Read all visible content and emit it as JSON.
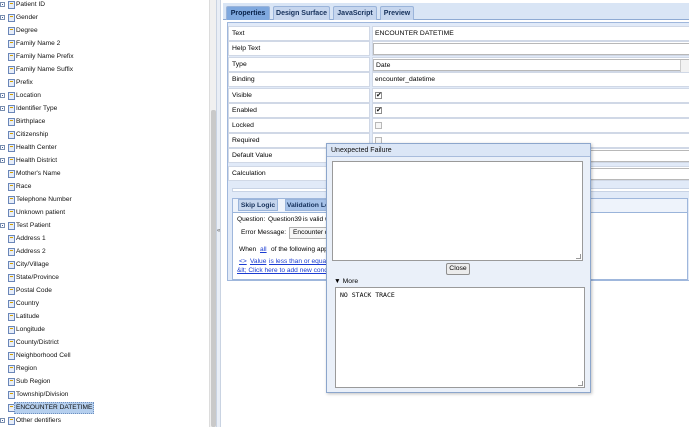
{
  "tree": {
    "items": [
      {
        "label": "Patient ID",
        "expandable": true
      },
      {
        "label": "Gender",
        "expandable": true
      },
      {
        "label": "Degree",
        "expandable": false
      },
      {
        "label": "Family Name 2",
        "expandable": false
      },
      {
        "label": "Family Name Prefix",
        "expandable": false
      },
      {
        "label": "Family Name Suffix",
        "expandable": false
      },
      {
        "label": "Prefix",
        "expandable": false
      },
      {
        "label": "Location",
        "expandable": true
      },
      {
        "label": "Identifier Type",
        "expandable": true
      },
      {
        "label": "Birthplace",
        "expandable": false
      },
      {
        "label": "Citizenship",
        "expandable": false
      },
      {
        "label": "Health Center",
        "expandable": true
      },
      {
        "label": "Health District",
        "expandable": true
      },
      {
        "label": "Mother's Name",
        "expandable": false
      },
      {
        "label": "Race",
        "expandable": false
      },
      {
        "label": "Telephone Number",
        "expandable": false
      },
      {
        "label": "Unknown patient",
        "expandable": false
      },
      {
        "label": "Test Patient",
        "expandable": true
      },
      {
        "label": "Address 1",
        "expandable": false
      },
      {
        "label": "Address 2",
        "expandable": false
      },
      {
        "label": "City/Village",
        "expandable": false
      },
      {
        "label": "State/Province",
        "expandable": false
      },
      {
        "label": "Postal Code",
        "expandable": false
      },
      {
        "label": "Country",
        "expandable": false
      },
      {
        "label": "Latitude",
        "expandable": false
      },
      {
        "label": "Longitude",
        "expandable": false
      },
      {
        "label": "County/District",
        "expandable": false
      },
      {
        "label": "Neighborhood Cell",
        "expandable": false
      },
      {
        "label": "Region",
        "expandable": false
      },
      {
        "label": "Sub Region",
        "expandable": false
      },
      {
        "label": "Township/Division",
        "expandable": false
      },
      {
        "label": "ENCOUNTER DATETIME",
        "expandable": false,
        "selected": true
      },
      {
        "label": "Other dentifiers",
        "expandable": true
      }
    ]
  },
  "splitter": {
    "arrow": "«"
  },
  "tabs": [
    {
      "label": "Properties",
      "active": true
    },
    {
      "label": "Design Surface",
      "active": false
    },
    {
      "label": "JavaScript",
      "active": false
    },
    {
      "label": "Preview",
      "active": false
    }
  ],
  "properties": [
    {
      "label": "Text",
      "kind": "text",
      "value": "ENCOUNTER DATETIME"
    },
    {
      "label": "Help Text",
      "kind": "input",
      "value": ""
    },
    {
      "label": "Type",
      "kind": "select",
      "value": "Date"
    },
    {
      "label": "Binding",
      "kind": "text",
      "value": "encounter_datetime"
    },
    {
      "label": "Visible",
      "kind": "check",
      "checked": true
    },
    {
      "label": "Enabled",
      "kind": "check",
      "checked": true
    },
    {
      "label": "Locked",
      "kind": "check",
      "checked": false
    },
    {
      "label": "Required",
      "kind": "check",
      "checked": false
    },
    {
      "label": "Default Value",
      "kind": "input",
      "value": ""
    },
    {
      "label": "Calculation",
      "kind": "input",
      "value": ""
    }
  ],
  "subtabs": [
    {
      "label": "Skip Logic",
      "active": false
    },
    {
      "label": "Validation Lo",
      "active": true
    }
  ],
  "validation": {
    "question_label": "Question:",
    "question_value": "Question39",
    "question_suffix": "is valid w",
    "error_label": "Error Message:",
    "error_value": "Encounter da",
    "when_prefix": "When",
    "when_link": "all",
    "when_suffix": "of the following apply",
    "condition_arrow": "<>",
    "condition_value": "Value",
    "condition_text": "is less than or equal t",
    "add_condition": "&lt; Click here to add new conditi"
  },
  "dialog": {
    "title": "Unexpected Failure",
    "close_label": "Close",
    "more_label": "More",
    "more_icon": "triangle-down",
    "stack_trace": "NO STACK TRACE"
  }
}
